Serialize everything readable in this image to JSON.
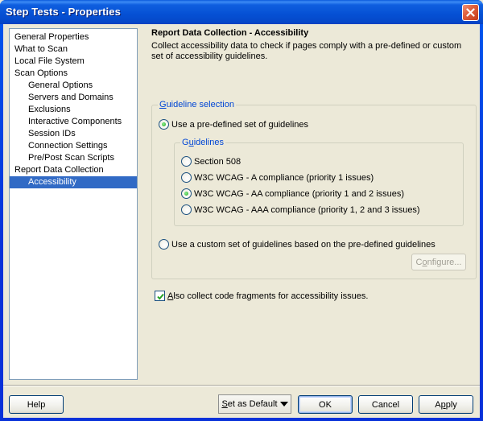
{
  "window": {
    "title": "Step Tests - Properties",
    "close_icon": "close-icon"
  },
  "tree": {
    "items": [
      {
        "label": "General Properties",
        "level": 0,
        "selected": false
      },
      {
        "label": "What to Scan",
        "level": 0,
        "selected": false
      },
      {
        "label": "Local File System",
        "level": 0,
        "selected": false
      },
      {
        "label": "Scan Options",
        "level": 0,
        "selected": false
      },
      {
        "label": "General Options",
        "level": 1,
        "selected": false
      },
      {
        "label": "Servers and Domains",
        "level": 1,
        "selected": false
      },
      {
        "label": "Exclusions",
        "level": 1,
        "selected": false
      },
      {
        "label": "Interactive Components",
        "level": 1,
        "selected": false
      },
      {
        "label": "Session IDs",
        "level": 1,
        "selected": false
      },
      {
        "label": "Connection Settings",
        "level": 1,
        "selected": false
      },
      {
        "label": "Pre/Post Scan Scripts",
        "level": 1,
        "selected": false
      },
      {
        "label": "Report Data Collection",
        "level": 0,
        "selected": false
      },
      {
        "label": "Accessibility",
        "level": 1,
        "selected": true
      }
    ]
  },
  "panel": {
    "title": "Report Data Collection - Accessibility",
    "description": "Collect accessibility data to check if pages comply with a pre-defined or custom set of accessibility guidelines.",
    "guideline_selection": {
      "legend_accel": "G",
      "legend_rest": "uideline selection",
      "predefined_label": "Use a pre-defined set of guidelines",
      "predefined_checked": true,
      "guidelines": {
        "legend_pre": "G",
        "legend_accel": "u",
        "legend_rest": "idelines",
        "options": [
          {
            "label": "Section 508",
            "checked": false
          },
          {
            "label": "W3C WCAG - A compliance (priority 1 issues)",
            "checked": false
          },
          {
            "label": "W3C WCAG - AA compliance (priority 1 and 2 issues)",
            "checked": true
          },
          {
            "label": "W3C WCAG - AAA compliance (priority 1, 2 and 3 issues)",
            "checked": false
          }
        ]
      },
      "custom_label": "Use a custom set of guidelines based on the pre-defined guidelines",
      "custom_checked": false,
      "configure_pre": "C",
      "configure_accel": "o",
      "configure_rest": "nfigure...",
      "configure_enabled": false
    },
    "code_fragments": {
      "accel": "A",
      "rest": "lso collect code fragments for accessibility issues.",
      "checked": true
    }
  },
  "footer": {
    "help_label": "Help",
    "set_default_accel": "S",
    "set_default_rest": "et as Default",
    "ok_label": "OK",
    "cancel_label": "Cancel",
    "apply_pre": "A",
    "apply_accel": "p",
    "apply_rest": "ply"
  },
  "colors": {
    "selection": "#316ac5",
    "group_legend": "#0046d5",
    "title_bar": "#0550d4",
    "close_button": "#e0603c",
    "radio_dot": "#21a121"
  }
}
